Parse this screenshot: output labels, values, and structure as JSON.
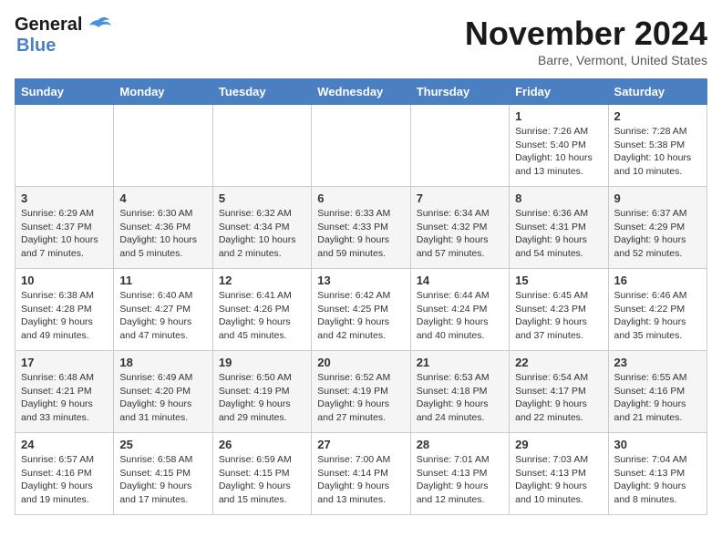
{
  "header": {
    "logo_general": "General",
    "logo_blue": "Blue",
    "month": "November 2024",
    "location": "Barre, Vermont, United States"
  },
  "days_of_week": [
    "Sunday",
    "Monday",
    "Tuesday",
    "Wednesday",
    "Thursday",
    "Friday",
    "Saturday"
  ],
  "weeks": [
    [
      {
        "day": "",
        "info": ""
      },
      {
        "day": "",
        "info": ""
      },
      {
        "day": "",
        "info": ""
      },
      {
        "day": "",
        "info": ""
      },
      {
        "day": "",
        "info": ""
      },
      {
        "day": "1",
        "info": "Sunrise: 7:26 AM\nSunset: 5:40 PM\nDaylight: 10 hours and 13 minutes."
      },
      {
        "day": "2",
        "info": "Sunrise: 7:28 AM\nSunset: 5:38 PM\nDaylight: 10 hours and 10 minutes."
      }
    ],
    [
      {
        "day": "3",
        "info": "Sunrise: 6:29 AM\nSunset: 4:37 PM\nDaylight: 10 hours and 7 minutes."
      },
      {
        "day": "4",
        "info": "Sunrise: 6:30 AM\nSunset: 4:36 PM\nDaylight: 10 hours and 5 minutes."
      },
      {
        "day": "5",
        "info": "Sunrise: 6:32 AM\nSunset: 4:34 PM\nDaylight: 10 hours and 2 minutes."
      },
      {
        "day": "6",
        "info": "Sunrise: 6:33 AM\nSunset: 4:33 PM\nDaylight: 9 hours and 59 minutes."
      },
      {
        "day": "7",
        "info": "Sunrise: 6:34 AM\nSunset: 4:32 PM\nDaylight: 9 hours and 57 minutes."
      },
      {
        "day": "8",
        "info": "Sunrise: 6:36 AM\nSunset: 4:31 PM\nDaylight: 9 hours and 54 minutes."
      },
      {
        "day": "9",
        "info": "Sunrise: 6:37 AM\nSunset: 4:29 PM\nDaylight: 9 hours and 52 minutes."
      }
    ],
    [
      {
        "day": "10",
        "info": "Sunrise: 6:38 AM\nSunset: 4:28 PM\nDaylight: 9 hours and 49 minutes."
      },
      {
        "day": "11",
        "info": "Sunrise: 6:40 AM\nSunset: 4:27 PM\nDaylight: 9 hours and 47 minutes."
      },
      {
        "day": "12",
        "info": "Sunrise: 6:41 AM\nSunset: 4:26 PM\nDaylight: 9 hours and 45 minutes."
      },
      {
        "day": "13",
        "info": "Sunrise: 6:42 AM\nSunset: 4:25 PM\nDaylight: 9 hours and 42 minutes."
      },
      {
        "day": "14",
        "info": "Sunrise: 6:44 AM\nSunset: 4:24 PM\nDaylight: 9 hours and 40 minutes."
      },
      {
        "day": "15",
        "info": "Sunrise: 6:45 AM\nSunset: 4:23 PM\nDaylight: 9 hours and 37 minutes."
      },
      {
        "day": "16",
        "info": "Sunrise: 6:46 AM\nSunset: 4:22 PM\nDaylight: 9 hours and 35 minutes."
      }
    ],
    [
      {
        "day": "17",
        "info": "Sunrise: 6:48 AM\nSunset: 4:21 PM\nDaylight: 9 hours and 33 minutes."
      },
      {
        "day": "18",
        "info": "Sunrise: 6:49 AM\nSunset: 4:20 PM\nDaylight: 9 hours and 31 minutes."
      },
      {
        "day": "19",
        "info": "Sunrise: 6:50 AM\nSunset: 4:19 PM\nDaylight: 9 hours and 29 minutes."
      },
      {
        "day": "20",
        "info": "Sunrise: 6:52 AM\nSunset: 4:19 PM\nDaylight: 9 hours and 27 minutes."
      },
      {
        "day": "21",
        "info": "Sunrise: 6:53 AM\nSunset: 4:18 PM\nDaylight: 9 hours and 24 minutes."
      },
      {
        "day": "22",
        "info": "Sunrise: 6:54 AM\nSunset: 4:17 PM\nDaylight: 9 hours and 22 minutes."
      },
      {
        "day": "23",
        "info": "Sunrise: 6:55 AM\nSunset: 4:16 PM\nDaylight: 9 hours and 21 minutes."
      }
    ],
    [
      {
        "day": "24",
        "info": "Sunrise: 6:57 AM\nSunset: 4:16 PM\nDaylight: 9 hours and 19 minutes."
      },
      {
        "day": "25",
        "info": "Sunrise: 6:58 AM\nSunset: 4:15 PM\nDaylight: 9 hours and 17 minutes."
      },
      {
        "day": "26",
        "info": "Sunrise: 6:59 AM\nSunset: 4:15 PM\nDaylight: 9 hours and 15 minutes."
      },
      {
        "day": "27",
        "info": "Sunrise: 7:00 AM\nSunset: 4:14 PM\nDaylight: 9 hours and 13 minutes."
      },
      {
        "day": "28",
        "info": "Sunrise: 7:01 AM\nSunset: 4:13 PM\nDaylight: 9 hours and 12 minutes."
      },
      {
        "day": "29",
        "info": "Sunrise: 7:03 AM\nSunset: 4:13 PM\nDaylight: 9 hours and 10 minutes."
      },
      {
        "day": "30",
        "info": "Sunrise: 7:04 AM\nSunset: 4:13 PM\nDaylight: 9 hours and 8 minutes."
      }
    ]
  ]
}
